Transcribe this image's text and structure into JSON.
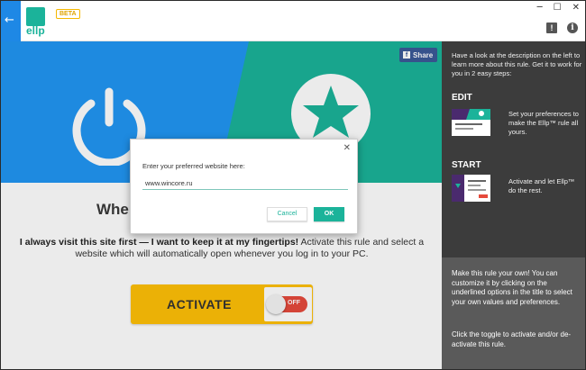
{
  "header": {
    "logo_text": "ellp",
    "badge": "BETA",
    "window_controls": [
      "─",
      "☐",
      "✕"
    ],
    "icons": [
      "back-arrow-icon",
      "feedback-icon",
      "info-icon"
    ]
  },
  "hero": {
    "share_label": "Share",
    "icons": [
      "power-icon",
      "star-icon"
    ],
    "colors": {
      "left": "#2196f3",
      "right": "#1bb39a"
    }
  },
  "rule": {
    "title_visible": "When",
    "description_bold": "I always visit this site first — I want to keep it at my fingertips!",
    "description_rest": " Activate this rule and select a website which will automatically open whenever you log in to your PC.",
    "activate_label": "ACTIVATE",
    "toggle_state": "OFF"
  },
  "side": {
    "intro": "Have a look at the description on the left to learn more about this rule. Get it to work for you in 2 easy steps:",
    "steps": [
      {
        "title": "EDIT",
        "text": "Set your preferences to make the Ellp™ rule all yours."
      },
      {
        "title": "START",
        "text": "Activate and let Ellp™ do the rest."
      }
    ],
    "help_1": "Make this rule your own! You can customize it by clicking on the underlined options in the title to select your own values and preferences.",
    "help_2": "Click the toggle to activate and/or de-activate this rule."
  },
  "dialog": {
    "label": "Enter your preferred website here:",
    "input_value": "www.wincore.ru",
    "cancel_label": "Cancel",
    "ok_label": "OK",
    "close_glyph": "✕"
  }
}
